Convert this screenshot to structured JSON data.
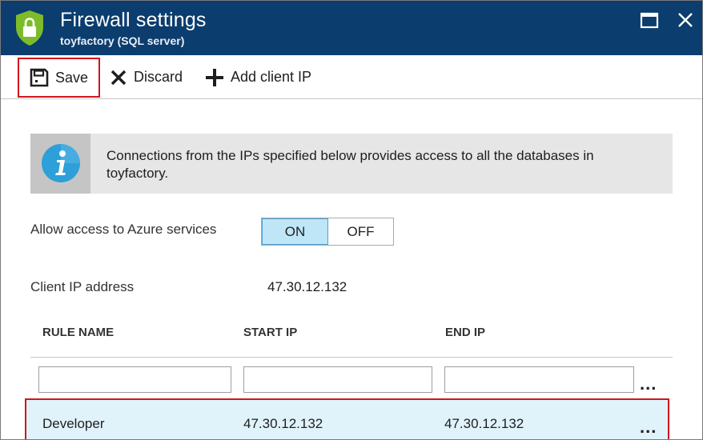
{
  "header": {
    "title": "Firewall settings",
    "subtitle": "toyfactory (SQL server)",
    "icon": "shield-lock-icon",
    "colors": {
      "background": "#0b3d6e",
      "shield": "#7cbc2a"
    }
  },
  "toolbar": {
    "save_label": "Save",
    "discard_label": "Discard",
    "add_client_ip_label": "Add client IP"
  },
  "info": {
    "icon": "info-icon",
    "text": "Connections from the IPs specified below provides access to all the databases in toyfactory."
  },
  "azure_access": {
    "label": "Allow access to Azure services",
    "on_label": "ON",
    "off_label": "OFF",
    "selected": "ON"
  },
  "client_ip": {
    "label": "Client IP address",
    "value": "47.30.12.132"
  },
  "rules_table": {
    "columns": [
      "RULE NAME",
      "START IP",
      "END IP"
    ],
    "new_rule": {
      "name": "",
      "start_ip": "",
      "end_ip": ""
    },
    "more_label": "...",
    "rows": [
      {
        "name": "Developer",
        "start_ip": "47.30.12.132",
        "end_ip": "47.30.12.132",
        "more_label": "..."
      }
    ]
  },
  "colors": {
    "highlight_border": "#d0161e",
    "toggle_on_bg": "#bfe6f6",
    "selected_row_bg": "#e0f3fb"
  }
}
